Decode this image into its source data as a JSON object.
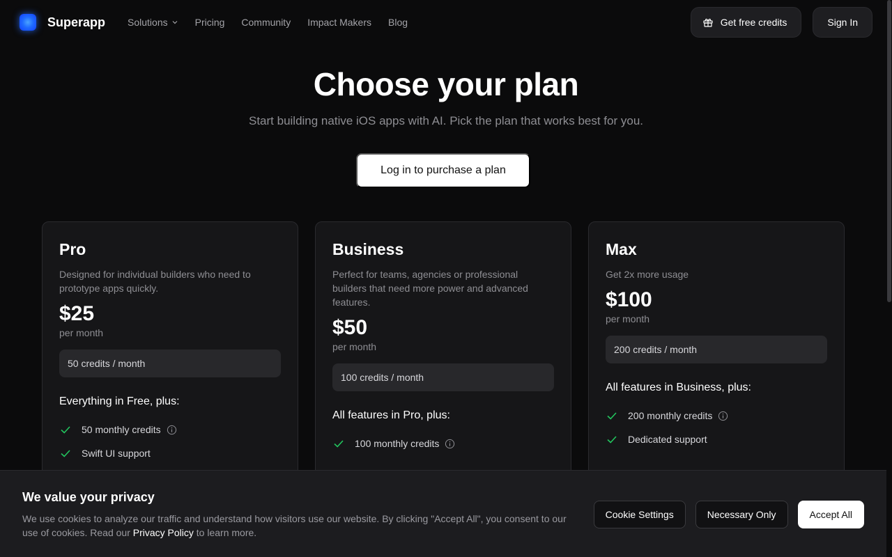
{
  "nav": {
    "brand": "Superapp",
    "links": [
      "Solutions",
      "Pricing",
      "Community",
      "Impact Makers",
      "Blog"
    ],
    "credits_label": "Get free credits",
    "signin_label": "Sign In"
  },
  "hero": {
    "title": "Choose your plan",
    "subtitle": "Start building native iOS apps with AI. Pick the plan that works best for you.",
    "login_label": "Log in to purchase a plan"
  },
  "plans": [
    {
      "name": "Pro",
      "description": "Designed for individual builders who need to prototype apps quickly.",
      "price": "$25",
      "period": "per month",
      "credits": "50 credits / month",
      "features_heading": "Everything in Free, plus:",
      "features": [
        "50 monthly credits",
        "Swift UI support"
      ]
    },
    {
      "name": "Business",
      "description": "Perfect for teams, agencies or professional builders that need more power and advanced features.",
      "price": "$50",
      "period": "per month",
      "credits": "100 credits / month",
      "features_heading": "All features in Pro, plus:",
      "features": [
        "100 monthly credits"
      ]
    },
    {
      "name": "Max",
      "description": "Get 2x more usage",
      "price": "$100",
      "period": "per month",
      "credits": "200 credits / month",
      "features_heading": "All features in Business, plus:",
      "features": [
        "200 monthly credits",
        "Dedicated support"
      ]
    }
  ],
  "cookie": {
    "title": "We value your privacy",
    "text_before": "We use cookies to analyze our traffic and understand how visitors use our website. By clicking \"Accept All\", you consent to our use of cookies. Read our ",
    "link": "Privacy Policy",
    "text_after": " to learn more.",
    "settings_label": "Cookie Settings",
    "necessary_label": "Necessary Only",
    "accept_label": "Accept All"
  },
  "colors": {
    "background": "#0b0b0c",
    "card": "#161618",
    "check": "#22c55e",
    "accent": "#1f6bff"
  },
  "icons": {
    "logo": "superapp-logo-icon",
    "credits": "gift-icon",
    "chevron": "chevron-down-icon",
    "check": "check-icon",
    "info": "info-icon"
  }
}
